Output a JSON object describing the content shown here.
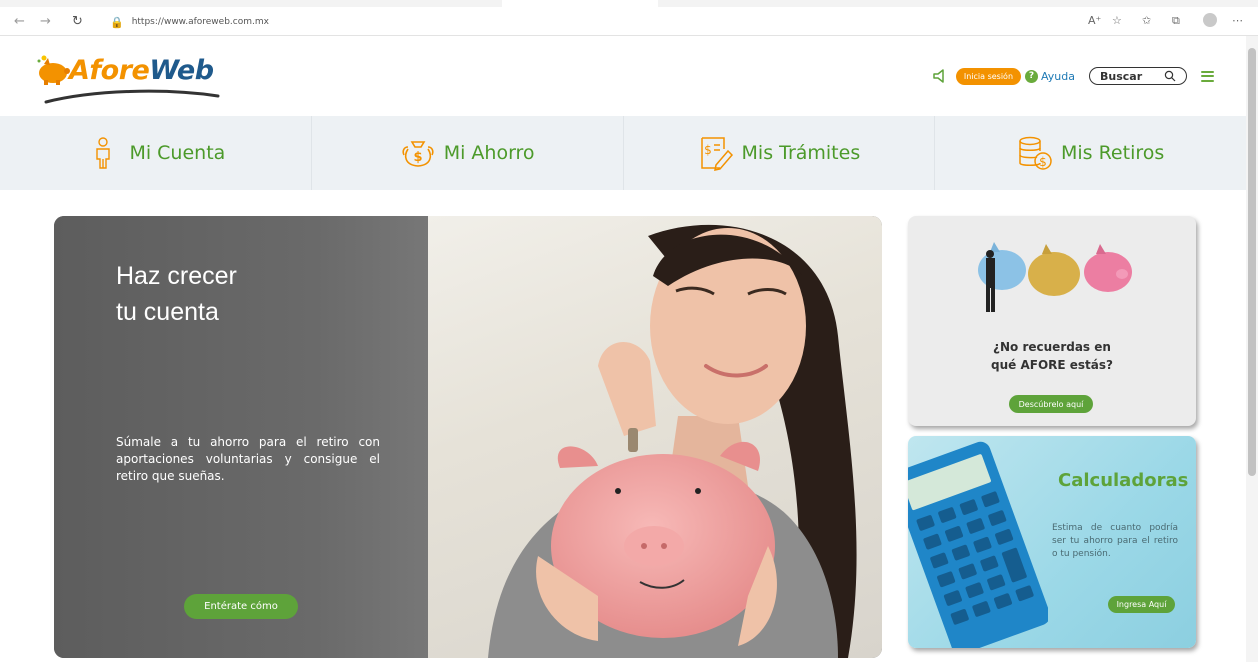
{
  "browser": {
    "url": "https://www.aforeweb.com.mx",
    "icons": [
      "back-icon",
      "forward-icon",
      "reload-icon",
      "lock-icon",
      "read-aloud-icon",
      "add-favorite-icon",
      "favorites-icon",
      "collections-icon",
      "profile-icon",
      "more-icon"
    ]
  },
  "header": {
    "logo": {
      "part1": "Afore",
      "part2": "Web"
    },
    "login_label": "Inicia sesión",
    "help_label": "Ayuda",
    "help_symbol": "?",
    "search_label": "Buscar"
  },
  "nav": {
    "items": [
      {
        "label": "Mi Cuenta",
        "icon": "person-icon"
      },
      {
        "label": "Mi Ahorro",
        "icon": "money-bag-icon"
      },
      {
        "label": "Mis Trámites",
        "icon": "document-edit-icon"
      },
      {
        "label": "Mis Retiros",
        "icon": "coins-icon"
      }
    ]
  },
  "hero": {
    "title_line1": "Haz crecer",
    "title_line2": "tu cuenta",
    "text": "Súmale a tu ahorro para el retiro con aportaciones voluntarias y consigue el retiro que sueñas.",
    "button": "Entérate cómo"
  },
  "card_afore": {
    "question_line1": "¿No recuerdas en",
    "question_line2": "qué AFORE estás?",
    "button": "Descúbrelo aquí"
  },
  "card_calc": {
    "title": "Calculadoras",
    "text": "Estima de cuanto podría ser tu ahorro para el retiro o tu pensión.",
    "button": "Ingresa Aquí"
  },
  "colors": {
    "brand_green": "#5ea33a",
    "brand_orange": "#f39200",
    "brand_blue": "#1f5a8c"
  }
}
